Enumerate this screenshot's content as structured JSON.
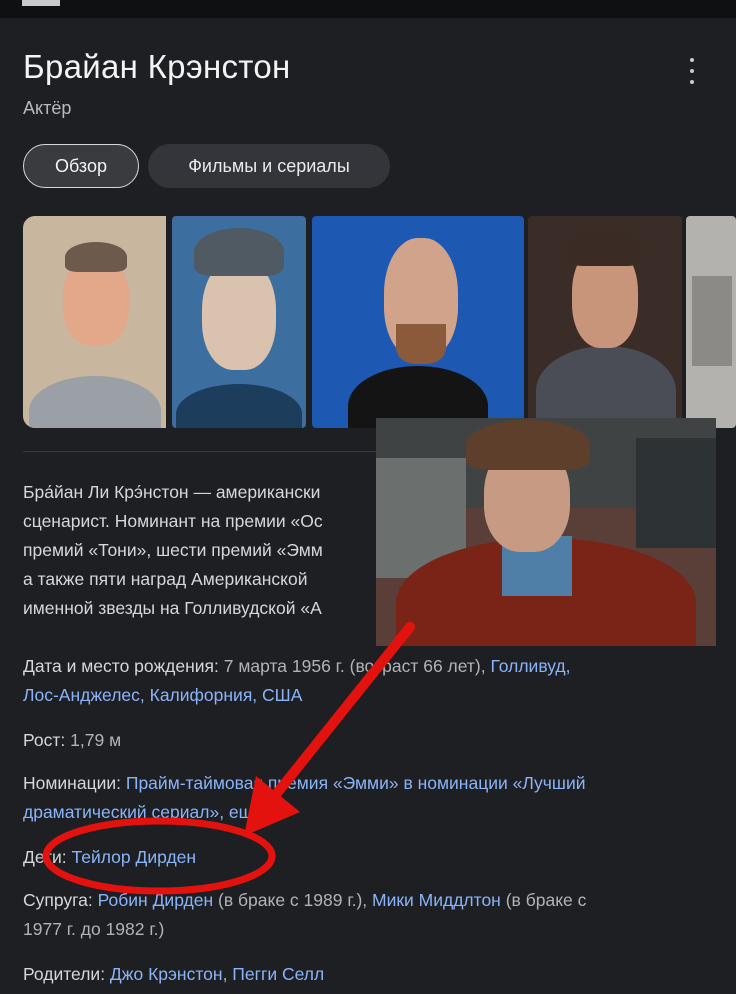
{
  "knowledge_panel": {
    "title": "Брайан Крэнстон",
    "subtitle": "Актёр",
    "tabs": [
      "Обзор",
      "Фильмы и сериалы"
    ],
    "description_lines": [
      "Бра́йан Ли Крэ́нстон — американски",
      "сценарист. Номинант на премии «Ос",
      "премий «Тони», шести премий «Эмм",
      "а также пяти наград Американской",
      "именной звезды на Голливудской «А"
    ],
    "facts": {
      "birth": {
        "label": "Дата и место рождения: ",
        "value": "7 марта 1956 г. (возраст 66 лет), ",
        "link": "Голливуд,",
        "link2": "Лос-Анджелес, Калифорния, США"
      },
      "height": {
        "label": "Рост: ",
        "value": "1,79 м"
      },
      "nominations": {
        "label": "Номинации: ",
        "link": "Прайм-таймовая премия «Эмми» в номинации «Лучший",
        "link2": "драматический сериал»",
        "more": ", ещё"
      },
      "children": {
        "label": "Дети: ",
        "link": "Тейлор Дирден"
      },
      "spouse": {
        "label": "Супруга: ",
        "link": "Робин Дирден",
        "value": " (в браке с 1989 г.), ",
        "link2": "Мики Миддлтон",
        "value2": " (в браке с",
        "value3": "1977 г. до 1982 г.)"
      },
      "parents": {
        "label": "Родители: ",
        "link": "Джо Крэнстон",
        "sep": ", ",
        "link2": "Пегги Селл"
      }
    }
  },
  "colors": {
    "background": "#1e1f23",
    "link": "#8ab4f8",
    "annotation_red": "#e3120f"
  },
  "icons": {
    "menu": "more-vertical-icon"
  }
}
